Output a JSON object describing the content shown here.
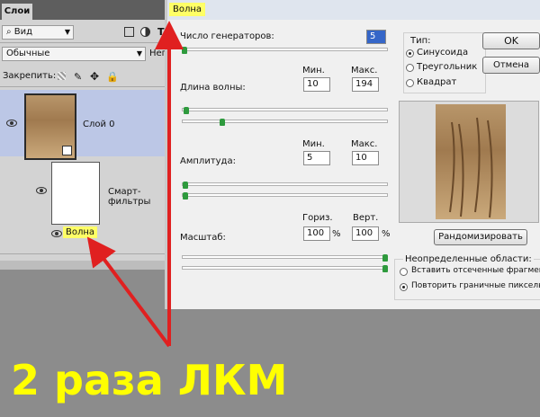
{
  "layers_panel": {
    "tab_label": "Слои",
    "kind_label": "Вид",
    "blend_mode": "Обычные",
    "opacity_label": "Неп",
    "lock_label": "Закрепить:",
    "layer0_name": "Слой 0",
    "smart_filters_label": "Смарт-фильтры",
    "filter_name": "Волна"
  },
  "dialog": {
    "title": "Волна",
    "generators_label": "Число генераторов:",
    "generators_value": "5",
    "wavelength_label": "Длина волны:",
    "wavelength_min_label": "Мин.",
    "wavelength_max_label": "Макс.",
    "wavelength_min": "10",
    "wavelength_max": "194",
    "amplitude_label": "Амплитуда:",
    "amplitude_min_label": "Мин.",
    "amplitude_max_label": "Макс.",
    "amplitude_min": "5",
    "amplitude_max": "10",
    "scale_label": "Масштаб:",
    "horiz_label": "Гориз.",
    "vert_label": "Верт.",
    "horiz_value": "100",
    "vert_value": "100",
    "percent": "%",
    "type_label": "Тип:",
    "type_options": [
      "Синусоида",
      "Треугольник",
      "Квадрат"
    ],
    "ok_label": "OK",
    "cancel_label": "Отмена",
    "randomize_label": "Рандомизировать",
    "undefined_areas_label": "Неопределенные области:",
    "undefined_options": [
      "Вставить отсеченные фрагменты",
      "Повторить граничные пикселы"
    ]
  },
  "annotation": {
    "caption": "2 раза ЛКМ",
    "arrow_color": "#e02020",
    "highlight_color": "#ffff66",
    "caption_color": "#ffff00"
  }
}
